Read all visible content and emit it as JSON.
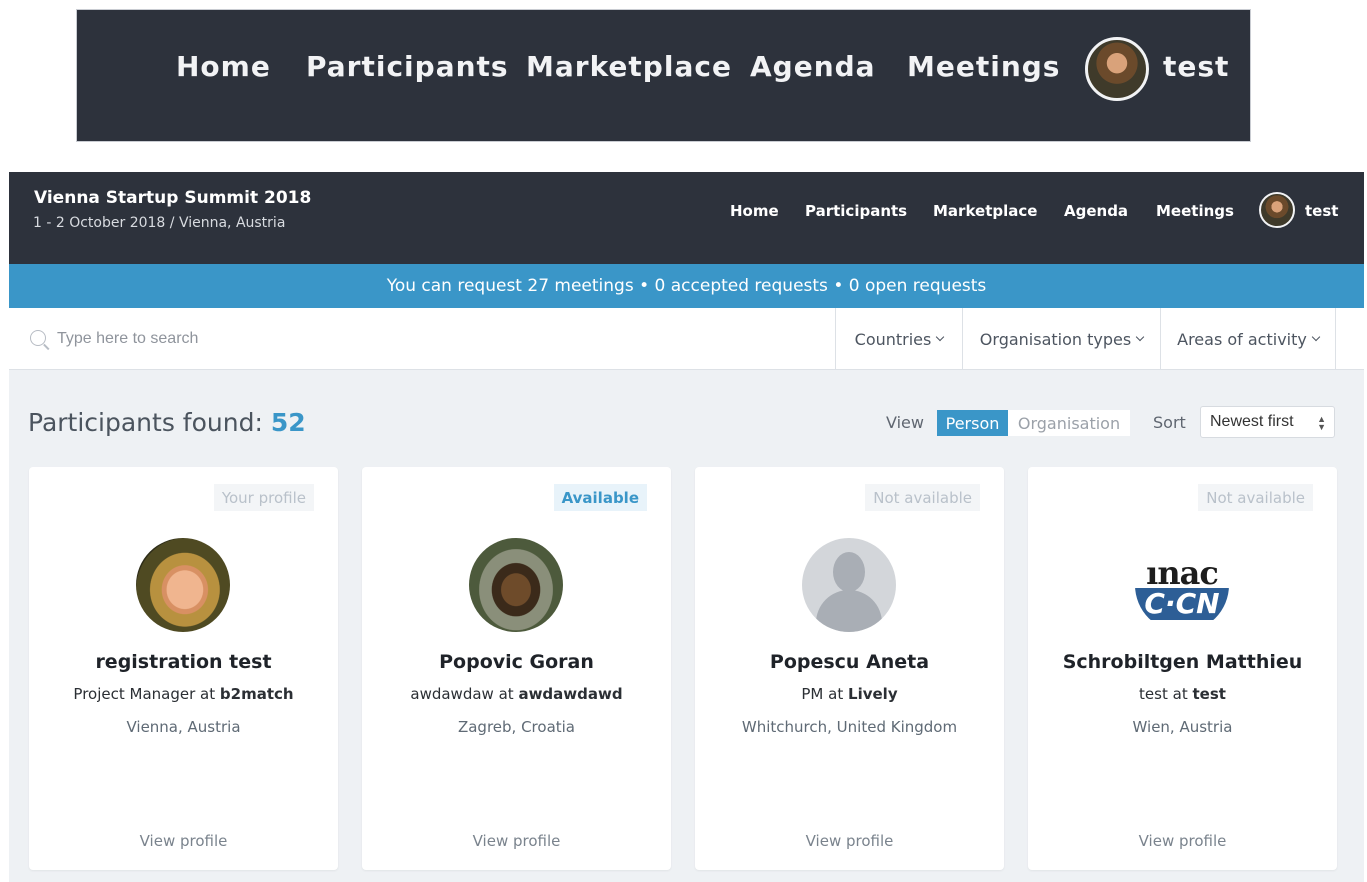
{
  "zoom_nav": {
    "items": [
      "Home",
      "Participants",
      "Marketplace",
      "Agenda",
      "Meetings"
    ],
    "user_name": "test"
  },
  "header": {
    "event_title": "Vienna Startup Summit 2018",
    "event_subtitle": "1 - 2 October 2018 / Vienna, Austria",
    "nav": [
      "Home",
      "Participants",
      "Marketplace",
      "Agenda",
      "Meetings"
    ],
    "user_name": "test"
  },
  "info_bar": {
    "text": "You can request 27 meetings • 0 accepted requests • 0 open requests"
  },
  "filters": {
    "search_placeholder": "Type here to search",
    "countries": "Countries",
    "org_types": "Organisation types",
    "areas": "Areas of activity"
  },
  "results": {
    "label": "Participants found:",
    "count": "52",
    "view_label": "View",
    "view_person": "Person",
    "view_organisation": "Organisation",
    "sort_label": "Sort",
    "sort_value": "Newest first"
  },
  "cards": [
    {
      "badge": "Your profile",
      "name": "registration test",
      "position": "Project Manager",
      "at": "at",
      "company": "b2match",
      "location": "Vienna, Austria",
      "link": "View profile",
      "photo": "woman-photo"
    },
    {
      "badge": "Available",
      "name": "Popovic Goran",
      "position": "awdawdaw",
      "at": "at",
      "company": "awdawdawd",
      "location": "Zagreb, Croatia",
      "link": "View profile",
      "photo": "dog-photo"
    },
    {
      "badge": "Not available",
      "name": "Popescu Aneta",
      "position": "PM",
      "at": "at",
      "company": "Lively",
      "location": "Whitchurch, United Kingdom",
      "link": "View profile",
      "photo": "default-avatar"
    },
    {
      "badge": "Not available",
      "name": "Schrobiltgen Matthieu",
      "position": "test",
      "at": "at",
      "company": "test",
      "location": "Wien, Austria",
      "link": "View profile",
      "photo": "logo-image",
      "logo_top": "ınac",
      "logo_band": "C·CN"
    }
  ],
  "colors": {
    "nav_bg": "#2d323c",
    "accent": "#3a96c8",
    "page_bg": "#eef1f4"
  }
}
